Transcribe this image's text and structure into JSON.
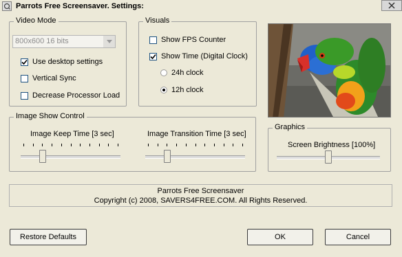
{
  "window": {
    "title": "Parrots Free Screensaver. Settings:"
  },
  "video_mode": {
    "legend": "Video Mode",
    "resolution_value": "800x600 16 bits",
    "use_desktop_settings": {
      "label": "Use desktop settings",
      "checked": true
    },
    "vertical_sync": {
      "label": "Vertical Sync",
      "checked": false
    },
    "decrease_processor_load": {
      "label": "Decrease Processor Load",
      "checked": false
    }
  },
  "visuals": {
    "legend": "Visuals",
    "show_fps": {
      "label": "Show FPS Counter",
      "checked": false
    },
    "show_time": {
      "label": "Show Time (Digital Clock)",
      "checked": true
    },
    "clock_24h": {
      "label": "24h clock",
      "selected": false
    },
    "clock_12h": {
      "label": "12h clock",
      "selected": true
    }
  },
  "image_show_control": {
    "legend": "Image Show Control",
    "keep_time": {
      "label": "Image Keep Time [3 sec]",
      "value_fraction": 0.2
    },
    "transition_time": {
      "label": "Image Transition Time [3 sec]",
      "value_fraction": 0.2
    }
  },
  "graphics": {
    "legend": "Graphics",
    "brightness": {
      "label": "Screen Brightness [100%]",
      "value_fraction": 0.5
    }
  },
  "info": {
    "line1": "Parrots Free Screensaver",
    "line2": "Copyright (c) 2008, SAVERS4FREE.COM. All Rights Reserved."
  },
  "buttons": {
    "restore_defaults": "Restore Defaults",
    "ok": "OK",
    "cancel": "Cancel"
  },
  "icons": {
    "app": "app-icon",
    "close": "close-icon",
    "dropdown": "chevron-down-icon",
    "check": "checkmark-icon"
  }
}
